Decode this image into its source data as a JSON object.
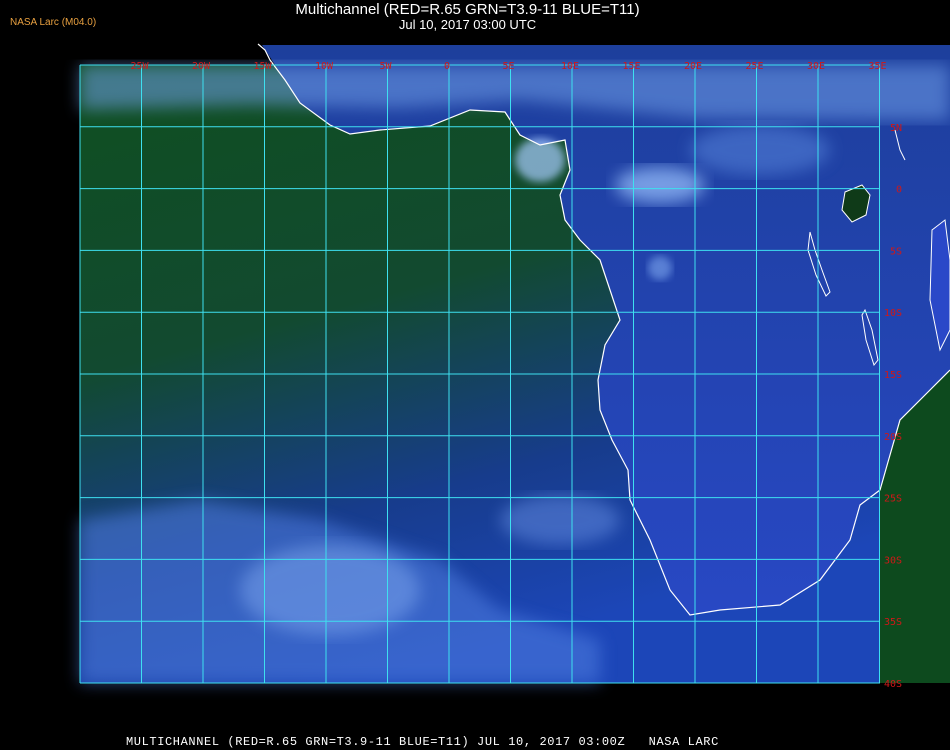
{
  "header": {
    "organization": "NASA Larc (M04.0)",
    "title": "Multichannel (RED=R.65 GRN=T3.9-11 BLUE=T11)",
    "datetime": "Jul 10, 2017 03:00 UTC"
  },
  "map": {
    "longitude_labels": [
      "25W",
      "20W",
      "15W",
      "10W",
      "5W",
      "0",
      "5E",
      "10E",
      "15E",
      "20E",
      "25E",
      "30E",
      "35E"
    ],
    "latitude_labels": [
      "5N",
      "0",
      "5S",
      "10S",
      "15S",
      "20S",
      "25S",
      "30S",
      "35S",
      "40S"
    ],
    "colors": {
      "grid": "#3ee0f0",
      "label": "#d01818",
      "coast": "#ffffff",
      "ocean_north": "#0e4a22",
      "ocean_south": "#1a3fa8",
      "land": "#2a48c8",
      "cloud": "#9fc8ff"
    }
  },
  "footer": {
    "caption": "MULTICHANNEL (RED=R.65 GRN=T3.9-11 BLUE=T11) JUL 10, 2017 03:00Z   NASA LARC"
  }
}
